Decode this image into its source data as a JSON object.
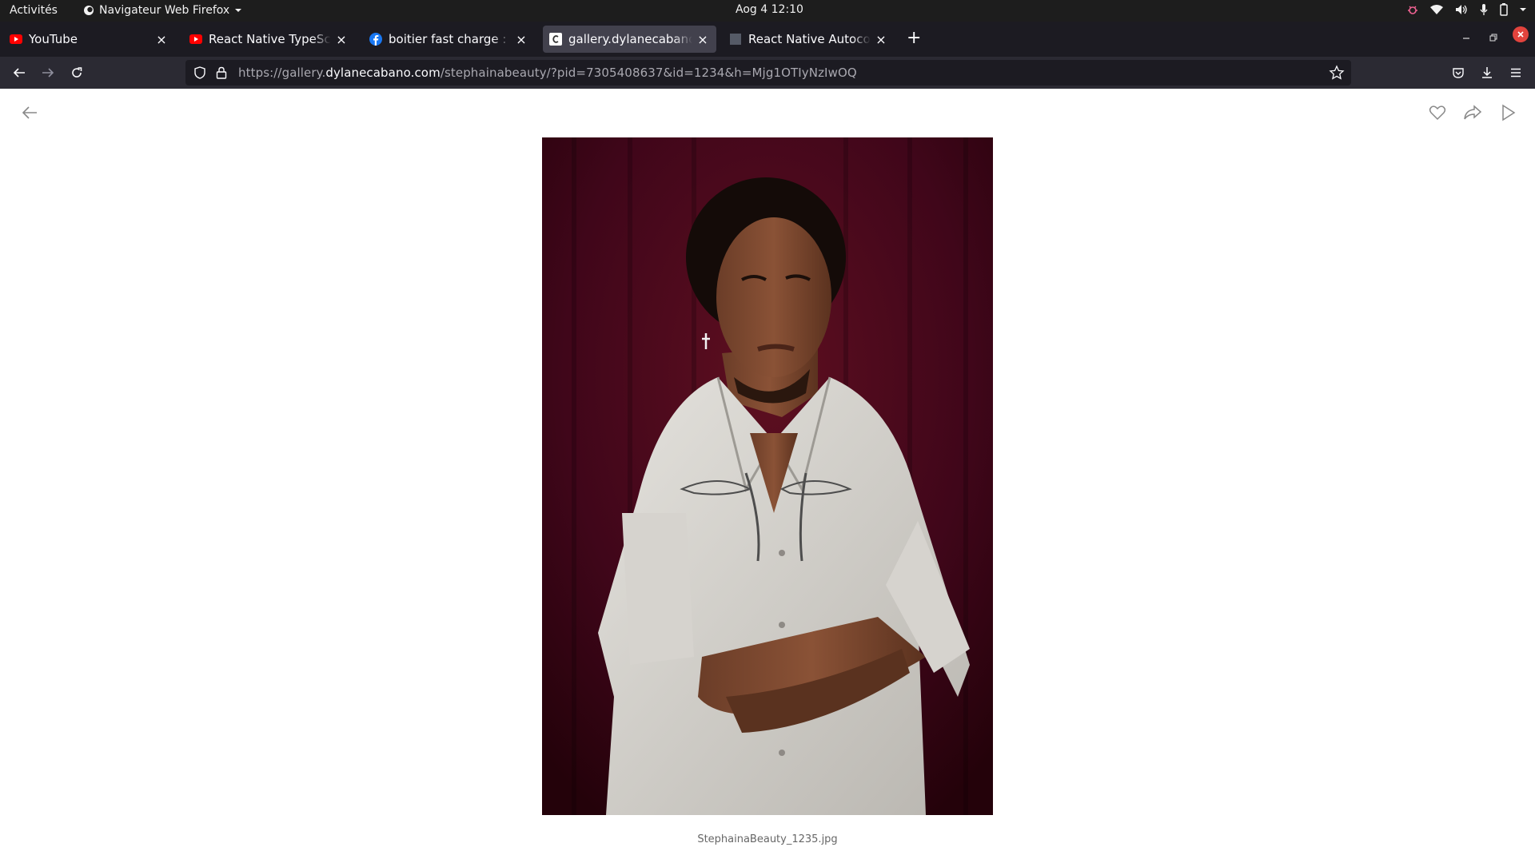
{
  "system": {
    "activities": "Activités",
    "app_menu": "Navigateur Web Firefox",
    "clock": "Aog 4  12:10"
  },
  "tabs": [
    {
      "title": "YouTube",
      "icon": "youtube-icon",
      "active": false
    },
    {
      "title": "React Native TypeScript - ",
      "icon": "youtube-icon",
      "active": false
    },
    {
      "title": "boitier fast charge : résul",
      "icon": "facebook-icon",
      "active": false
    },
    {
      "title": "gallery.dylanecabano.com",
      "icon": "gallery-icon",
      "active": true
    },
    {
      "title": "React Native Autocomple",
      "icon": "page-icon",
      "active": false
    }
  ],
  "url": {
    "prefix": "https://gallery.",
    "host": "dylanecabano.com",
    "path": "/stephainabeauty/?pid=7305408637&id=1234&h=Mjg1OTIyNzIwOQ"
  },
  "photo": {
    "caption": "StephainaBeauty_1235.jpg"
  },
  "colors": {
    "topbar": "#1d1d1d",
    "tabstrip": "#1c1b22",
    "active_tab": "#42414d",
    "navbar": "#2b2a33",
    "close_window": "#e2433d",
    "photo_bg": "#3f0613"
  }
}
